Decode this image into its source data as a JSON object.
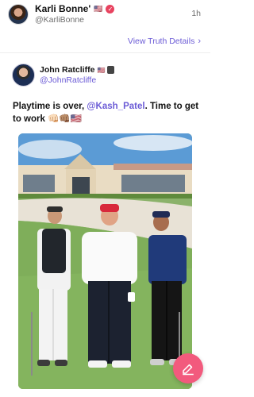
{
  "post": {
    "author_name": "Karli Bonne'",
    "author_flag": "🇺🇸",
    "author_handle": "@KarliBonne",
    "time_ago": "1h",
    "view_details_label": "View Truth Details",
    "view_details_chevron": "›"
  },
  "quoted": {
    "author_name": "John Ratcliffe",
    "author_flag": "🇺🇸",
    "author_handle": "@JohnRatcliffe",
    "text_before": "Playtime is over, ",
    "mention": "@Kash_Patel",
    "text_after": ". Time to get to work 👊🏻👊🏽🇺🇸"
  },
  "icons": {
    "verified": "verified-badge-icon",
    "view_details": "chevron-right-icon",
    "quoted_badge": "government-badge-icon",
    "compose": "compose-pen-icon"
  },
  "colors": {
    "accent": "#6b5bd6",
    "verified": "#e8425f",
    "fab": "#f25a7d"
  }
}
